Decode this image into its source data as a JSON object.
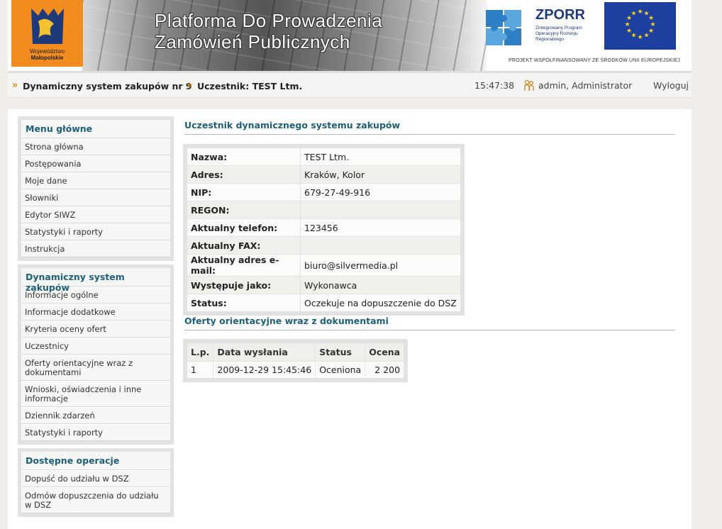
{
  "header": {
    "logo_caption_line1": "Województwo",
    "logo_caption_line2": "Małopolskie",
    "title_line1": "Platforma Do Prowadzenia",
    "title_line2": "Zamówień Publicznych",
    "zporr_title": "ZPORR",
    "zporr_subtitle": "Zintegrowany Program Operacyjny Rozwoju Regionalnego",
    "cofinancing": "PROJEKT WSPÓŁFINANSOWANY ZE ŚRODKÓW UNII EUROPEJSKIEJ"
  },
  "topbar": {
    "breadcrumbs": [
      "Dynamiczny system zakupów nr 9",
      "Uczestnik: TEST Ltm."
    ],
    "time": "15:47:38",
    "user": "admin, Administrator",
    "logout": "Wyloguj"
  },
  "sidebar": {
    "main_menu": {
      "title": "Menu główne",
      "items": [
        "Strona główna",
        "Postępowania",
        "Moje dane",
        "Słowniki",
        "Edytor SIWZ",
        "Statystyki i raporty",
        "Instrukcja"
      ]
    },
    "dsz_menu": {
      "title": "Dynamiczny system zakupów",
      "items": [
        "Informacje ogólne",
        "Informacje dodatkowe",
        "Kryteria oceny ofert",
        "Uczestnicy",
        "Oferty orientacyjne wraz z dokumentami",
        "Wnioski, oświadczenia i inne informacje",
        "Dziennik zdarzeń",
        "Statystyki i raporty"
      ]
    },
    "operations": {
      "title": "Dostępne operacje",
      "items": [
        "Dopuść do udziału w DSZ",
        "Odmów dopuszczenia do udziału w DSZ"
      ]
    }
  },
  "participant": {
    "heading": "Uczestnik dynamicznego systemu zakupów",
    "fields": [
      {
        "label": "Nazwa:",
        "value": "TEST Ltm."
      },
      {
        "label": "Adres:",
        "value": "Kraków, Kolor"
      },
      {
        "label": "NIP:",
        "value": "679-27-49-916"
      },
      {
        "label": "REGON:",
        "value": ""
      },
      {
        "label": "Aktualny telefon:",
        "value": "123456"
      },
      {
        "label": "Aktualny FAX:",
        "value": ""
      },
      {
        "label": "Aktualny adres e-mail:",
        "value": "biuro@silvermedia.pl"
      },
      {
        "label": "Występuje jako:",
        "value": "Wykonawca"
      },
      {
        "label": "Status:",
        "value": "Oczekuje na dopuszczenie do DSZ"
      }
    ]
  },
  "offers": {
    "heading": "Oferty orientacyjne wraz z dokumentami",
    "columns": [
      "L.p.",
      "Data wysłania",
      "Status",
      "Ocena"
    ],
    "rows": [
      [
        "1",
        "2009-12-29 15:45:46",
        "Oceniona",
        "2 200"
      ]
    ]
  },
  "colors": {
    "accent_teal": "#1c5f7a",
    "logo_orange": "#f28c1f",
    "eu_blue": "#1d3fa0",
    "crumb_arrow": "#e08a1d"
  }
}
